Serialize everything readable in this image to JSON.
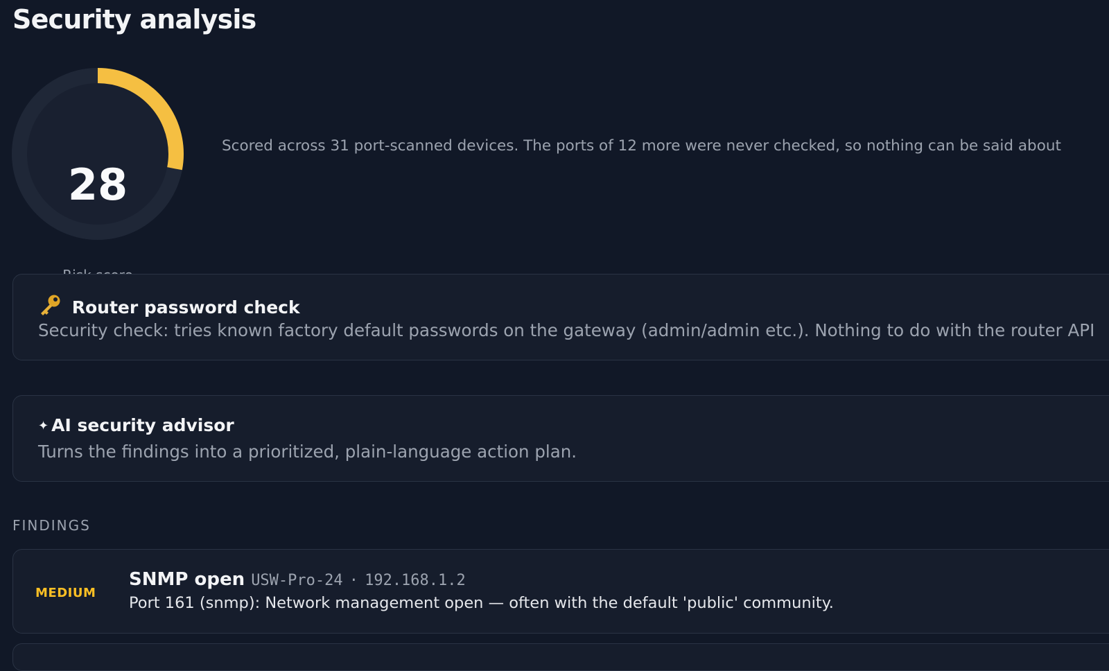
{
  "page": {
    "title": "Security analysis"
  },
  "risk": {
    "score": "28",
    "score_fraction": 0.28,
    "label": "Risk score",
    "note": "Scored across 31 port-scanned devices. The ports of 12 more were never checked, so nothing can be said about"
  },
  "cards": {
    "router_check": {
      "icon": "key-icon",
      "title": "Router password check",
      "description": "Security check: tries known factory default passwords on the gateway (admin/admin etc.). Nothing to do with the router API"
    },
    "ai_advisor": {
      "icon": "sparkle-icon",
      "title": "AI security advisor",
      "description": "Turns the findings into a prioritized, plain-language action plan."
    }
  },
  "findings": {
    "heading": "FINDINGS",
    "items": [
      {
        "severity": "MEDIUM",
        "title": "SNMP open",
        "device": "USW-Pro-24",
        "separator": "·",
        "ip": "192.168.1.2",
        "description": "Port 161 (snmp): Network management open — often with the default 'public' community."
      }
    ]
  },
  "colors": {
    "background": "#111827",
    "card": "#161d2c",
    "gauge_track": "#1f2737",
    "gauge_fill": "#f5bf42",
    "severity_medium": "#fbbf24"
  }
}
